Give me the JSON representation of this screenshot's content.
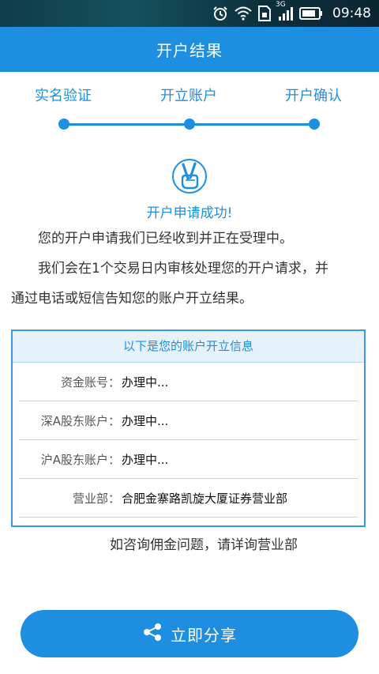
{
  "status_bar": {
    "time": "09:48",
    "network": "3G",
    "icons": [
      "alarm-icon",
      "wifi-icon",
      "sim-icon",
      "signal-icon",
      "battery-icon"
    ]
  },
  "header": {
    "title": "开户结果"
  },
  "steps": [
    {
      "label": "实名验证"
    },
    {
      "label": "开立账户"
    },
    {
      "label": "开户确认"
    }
  ],
  "success": {
    "icon": "victory-hand-icon",
    "title": "开户申请成功!"
  },
  "messages": {
    "line1": "您的开户申请我们已经收到并正在受理中。",
    "line2a": "我们会在1个交易日内审核处理您的开户请求，并",
    "line2b": "通过电话或短信告知您的账户开立结果。"
  },
  "info": {
    "header": "以下是您的账户开立信息",
    "rows": [
      {
        "key": "资金账号：",
        "value": "办理中..."
      },
      {
        "key": "深A股东账户：",
        "value": "办理中..."
      },
      {
        "key": "沪A股东账户：",
        "value": "办理中..."
      },
      {
        "key": "营业部：",
        "value": "合肥金寨路凯旋大厦证券营业部"
      }
    ]
  },
  "note": "如咨询佣金问题，请详询营业部",
  "share": {
    "label": "立即分享",
    "icon": "share-icon"
  },
  "colors": {
    "primary": "#1e8fe0",
    "info_header_bg": "#e5f1fb"
  }
}
